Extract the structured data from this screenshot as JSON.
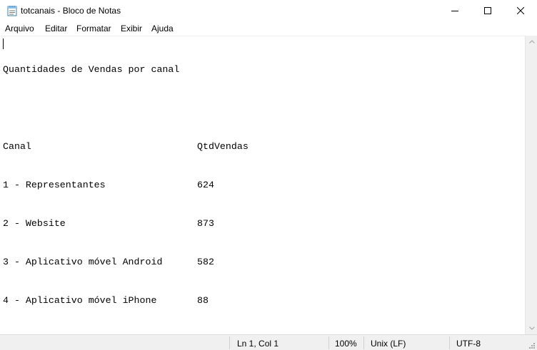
{
  "window": {
    "title": "totcanais - Bloco de Notas",
    "icon": "notepad-icon"
  },
  "menu": {
    "items": [
      "Arquivo",
      "Editar",
      "Formatar",
      "Exibir",
      "Ajuda"
    ]
  },
  "document": {
    "heading": "Quantidades de Vendas por canal",
    "header": {
      "col1": "Canal",
      "col2": "QtdVendas"
    },
    "rows": [
      {
        "canal": "1 - Representantes",
        "qtd": "624"
      },
      {
        "canal": "2 - Website",
        "qtd": "873"
      },
      {
        "canal": "3 - Aplicativo móvel Android",
        "qtd": "582"
      },
      {
        "canal": "4 - Aplicativo móvel iPhone",
        "qtd": "88"
      }
    ]
  },
  "status": {
    "position": "Ln 1, Col 1",
    "zoom": "100%",
    "line_ending": "Unix (LF)",
    "encoding": "UTF-8"
  }
}
